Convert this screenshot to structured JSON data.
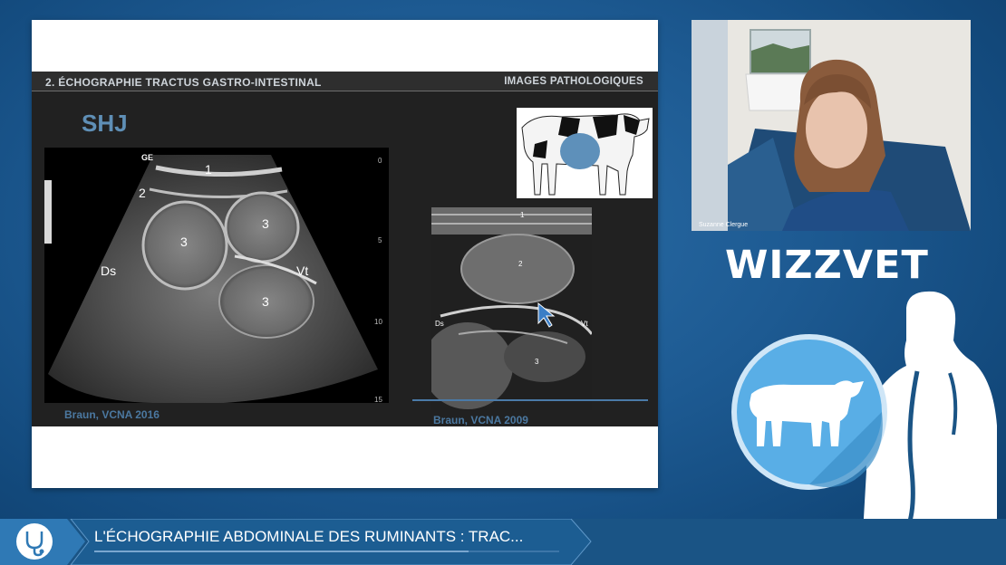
{
  "slide": {
    "section": "2. ÉCHOGRAPHIE TRACTUS GASTRO-INTESTINAL",
    "topic": "IMAGES PATHOLOGIQUES",
    "title": "SHJ",
    "image1": {
      "logo": "GE",
      "labels": [
        "1",
        "2",
        "3",
        "3",
        "3",
        "Ds",
        "Vt"
      ],
      "scale_ticks": [
        "0",
        "5",
        "10",
        "15"
      ],
      "citation": "Braun, VCNA 2016"
    },
    "image2": {
      "labels": [
        "1",
        "2",
        "Ds",
        "Vt",
        "3"
      ],
      "citation": "Braun, VCNA 2009"
    }
  },
  "webcam": {
    "participant_name": "Suzanne Clergue"
  },
  "brand": {
    "name": "WIZZVET"
  },
  "bottom_bar": {
    "title": "L'ÉCHOGRAPHIE ABDOMINALE DES RUMINANTS : TRAC..."
  },
  "icons": {
    "stethoscope": "stethoscope-icon",
    "cow": "cow-icon",
    "cursor": "cursor-icon"
  },
  "colors": {
    "background": "#1d5a92",
    "accent": "#4a7aa8",
    "circle": "#59aee6"
  }
}
